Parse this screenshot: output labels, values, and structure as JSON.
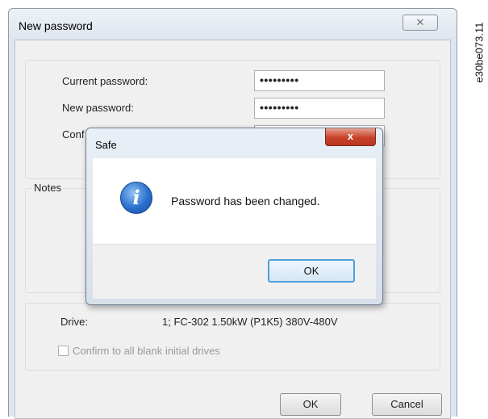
{
  "window": {
    "title": "New password",
    "close_glyph": "✕"
  },
  "passwords": {
    "current_label": "Current password:",
    "current_value": "•••••••••",
    "new_label": "New password:",
    "new_value": "•••••••••",
    "confirm_label_visible": "Conf"
  },
  "notes": {
    "label": "Notes"
  },
  "drive": {
    "label": "Drive:",
    "value": "1; FC-302 1.50kW (P1K5) 380V-480V",
    "confirm_checkbox_label": "Confirm to all blank initial drives",
    "confirm_checked": false
  },
  "buttons": {
    "ok": "OK",
    "cancel": "Cancel"
  },
  "dialog": {
    "title": "Safe",
    "close_glyph": "x",
    "icon": "info-icon",
    "icon_glyph": "i",
    "message": "Password has been changed.",
    "ok": "OK"
  },
  "figure_code": "e30be073.11",
  "colors": {
    "dialog_close_red": "#c74128",
    "info_blue": "#2a6fce",
    "focused_button_border": "#4f9fd9"
  }
}
